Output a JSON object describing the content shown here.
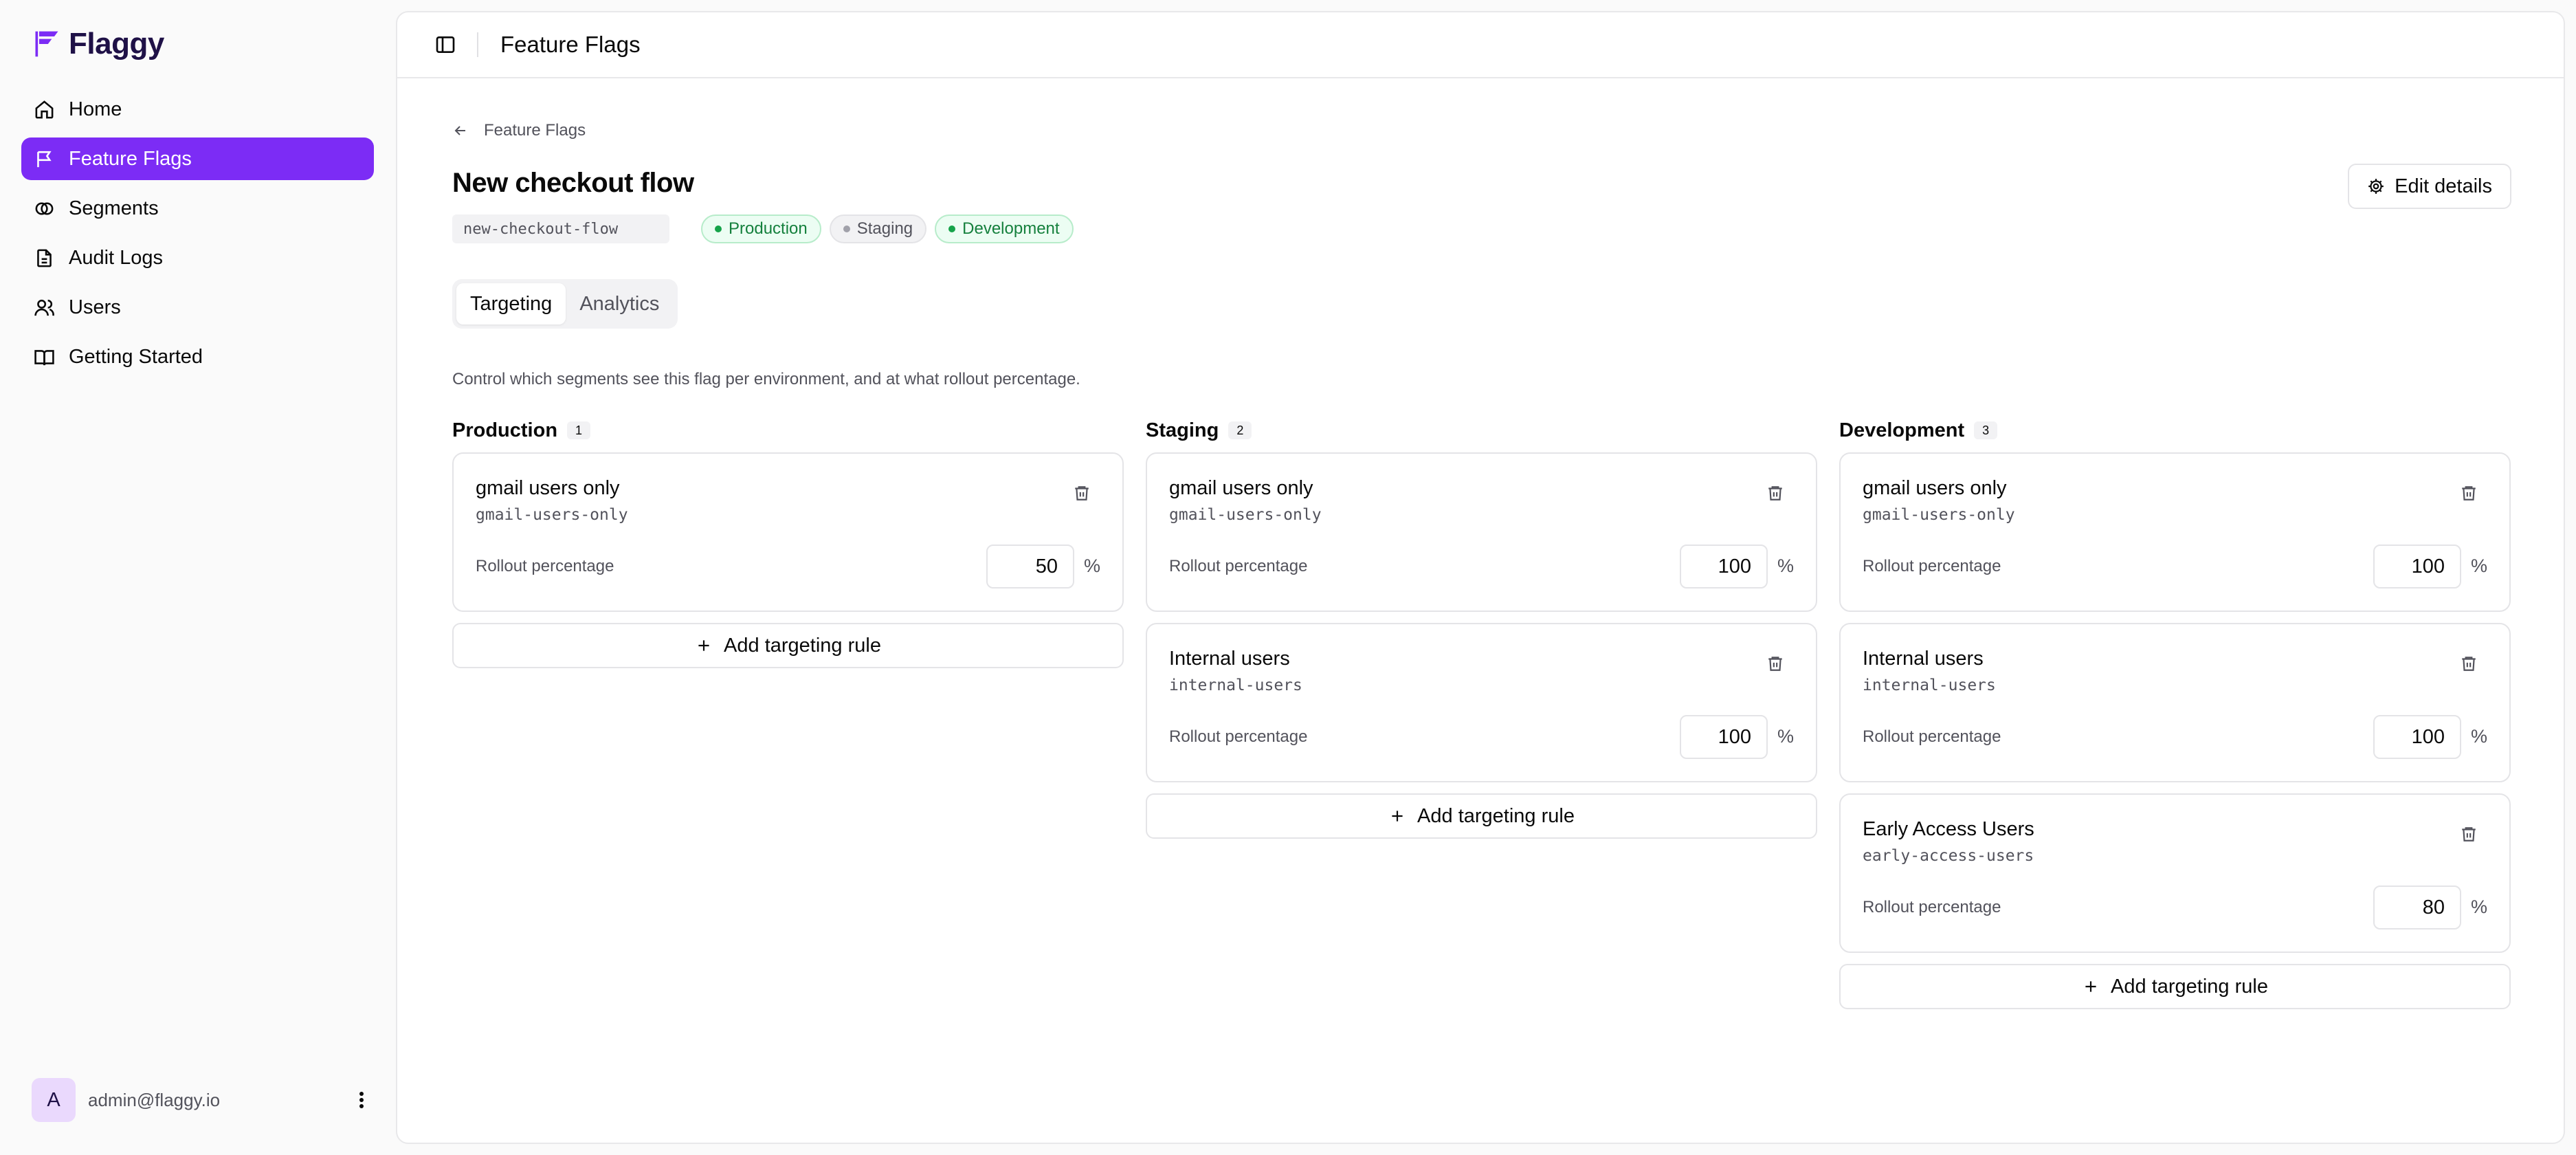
{
  "app": {
    "name": "Flaggy"
  },
  "colors": {
    "accent": "#7c2cf5",
    "success": "#16a34a",
    "muted": "#52525b"
  },
  "sidebar": {
    "items": [
      {
        "label": "Home",
        "icon": "home-icon",
        "active": false
      },
      {
        "label": "Feature Flags",
        "icon": "flag-icon",
        "active": true
      },
      {
        "label": "Segments",
        "icon": "segments-icon",
        "active": false
      },
      {
        "label": "Audit Logs",
        "icon": "file-text-icon",
        "active": false
      },
      {
        "label": "Users",
        "icon": "users-icon",
        "active": false
      },
      {
        "label": "Getting Started",
        "icon": "book-icon",
        "active": false
      }
    ],
    "user": {
      "avatar_initial": "A",
      "email": "admin@flaggy.io"
    }
  },
  "header": {
    "title": "Feature Flags"
  },
  "flag": {
    "back_label": "Feature Flags",
    "title": "New checkout flow",
    "key": "new-checkout-flow",
    "environments": [
      {
        "label": "Production",
        "enabled": true
      },
      {
        "label": "Staging",
        "enabled": false
      },
      {
        "label": "Development",
        "enabled": true
      }
    ],
    "edit_label": "Edit details"
  },
  "tabs": [
    {
      "label": "Targeting",
      "active": true
    },
    {
      "label": "Analytics",
      "active": false
    }
  ],
  "description": "Control which segments see this flag per environment, and at what rollout percentage.",
  "rollout_label": "Rollout percentage",
  "percent_sign": "%",
  "add_rule_label": "Add targeting rule",
  "columns": [
    {
      "title": "Production",
      "count": "1",
      "rules": [
        {
          "name": "gmail users only",
          "key": "gmail-users-only",
          "rollout": "50"
        }
      ]
    },
    {
      "title": "Staging",
      "count": "2",
      "rules": [
        {
          "name": "gmail users only",
          "key": "gmail-users-only",
          "rollout": "100"
        },
        {
          "name": "Internal users",
          "key": "internal-users",
          "rollout": "100"
        }
      ]
    },
    {
      "title": "Development",
      "count": "3",
      "rules": [
        {
          "name": "gmail users only",
          "key": "gmail-users-only",
          "rollout": "100"
        },
        {
          "name": "Internal users",
          "key": "internal-users",
          "rollout": "100"
        },
        {
          "name": "Early Access Users",
          "key": "early-access-users",
          "rollout": "80"
        }
      ]
    }
  ]
}
